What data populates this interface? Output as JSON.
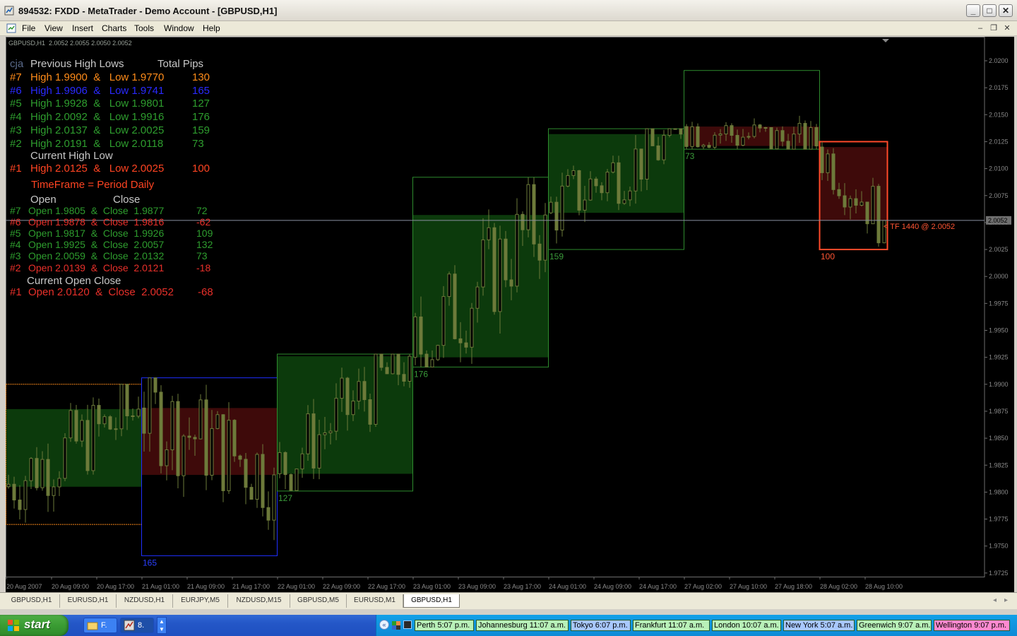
{
  "window": {
    "title": "894532: FXDD - MetaTrader - Demo Account - [GBPUSD,H1]",
    "minimize": "_",
    "maximize": "□",
    "close": "✕"
  },
  "menu": {
    "items": [
      "File",
      "View",
      "Insert",
      "Charts",
      "Tools",
      "Window",
      "Help"
    ]
  },
  "chart": {
    "header": "GBPUSD,H1  2.0052 2.0055 2.0050 2.0052",
    "current_price_tag": "2.0052",
    "tf_label": "< TF 1440  @  2.0052",
    "price_axis": [
      "2.0200",
      "2.0175",
      "2.0150",
      "2.0125",
      "2.0100",
      "2.0075",
      "2.0050",
      "2.0025",
      "2.0000",
      "1.9975",
      "1.9950",
      "1.9925",
      "1.9900",
      "1.9875",
      "1.9850",
      "1.9825",
      "1.9800",
      "1.9775",
      "1.9750",
      "1.9725"
    ],
    "time_axis": [
      "20 Aug 2007",
      "20 Aug 09:00",
      "20 Aug 17:00",
      "21 Aug 01:00",
      "21 Aug 09:00",
      "21 Aug 17:00",
      "22 Aug 01:00",
      "22 Aug 09:00",
      "22 Aug 17:00",
      "23 Aug 01:00",
      "23 Aug 09:00",
      "23 Aug 17:00",
      "24 Aug 01:00",
      "24 Aug 09:00",
      "24 Aug 17:00",
      "27 Aug 02:00",
      "27 Aug 10:00",
      "27 Aug 18:00",
      "28 Aug 02:00",
      "28 Aug 10:00"
    ],
    "day_boxes": [
      {
        "pips": "",
        "high": 1.99,
        "low": 1.977,
        "open": 1.9805,
        "close": 1.9877,
        "border": "#ff8c1a"
      },
      {
        "pips": "165",
        "high": 1.9906,
        "low": 1.9741,
        "open": 1.9878,
        "close": 1.9816,
        "border": "#1f2fff"
      },
      {
        "pips": "127",
        "high": 1.9928,
        "low": 1.9801,
        "open": 1.9817,
        "close": 1.9926,
        "border": "#2e8b2e"
      },
      {
        "pips": "176",
        "high": 2.0092,
        "low": 1.9916,
        "open": 1.9925,
        "close": 2.0057,
        "border": "#2e8b2e"
      },
      {
        "pips": "159",
        "high": 2.0137,
        "low": 2.0025,
        "open": 2.0059,
        "close": 2.0132,
        "border": "#2e8b2e"
      },
      {
        "pips": "73",
        "high": 2.0191,
        "low": 2.0118,
        "open": 2.0139,
        "close": 2.0121,
        "border": "#2e8b2e"
      },
      {
        "pips": "100",
        "high": 2.0125,
        "low": 2.0025,
        "open": 2.012,
        "close": 2.0052,
        "border": "#ff4a2a"
      }
    ]
  },
  "panel": {
    "title_prefix": "cja",
    "title": "Previous High Lows",
    "total_pips": "Total Pips",
    "hl_rows": [
      {
        "id": "#7",
        "text": "High 1.9900  &   Low 1.9770",
        "pips": "130",
        "color": "#ff8c1a"
      },
      {
        "id": "#6",
        "text": "High 1.9906  &   Low 1.9741",
        "pips": "165",
        "color": "#2a2aff"
      },
      {
        "id": "#5",
        "text": "High 1.9928  &   Low 1.9801",
        "pips": "127",
        "color": "#2e9d2e"
      },
      {
        "id": "#4",
        "text": "High 2.0092  &   Low 1.9916",
        "pips": "176",
        "color": "#2e9d2e"
      },
      {
        "id": "#3",
        "text": "High 2.0137  &   Low 2.0025",
        "pips": "159",
        "color": "#2e9d2e"
      },
      {
        "id": "#2",
        "text": "High 2.0191  &   Low 2.0118",
        "pips": "73",
        "color": "#2e9d2e"
      }
    ],
    "current_hl_label": "Current High Low",
    "current_hl": {
      "id": "#1",
      "text": "High 2.0125  &   Low 2.0025",
      "pips": "100",
      "color": "#ff4422"
    },
    "timeframe": "TimeFrame = Period Daily",
    "open_label": "Open",
    "close_label": "Close",
    "oc_rows": [
      {
        "id": "#7",
        "text": "Open 1.9805  &  Close  1.9877",
        "pips": "72",
        "color": "#2e9d2e"
      },
      {
        "id": "#6",
        "text": "Open 1.9878  &  Close  1.9816",
        "pips": "-62",
        "color": "#e8302a"
      },
      {
        "id": "#5",
        "text": "Open 1.9817  &  Close  1.9926",
        "pips": "109",
        "color": "#2e9d2e"
      },
      {
        "id": "#4",
        "text": "Open 1.9925  &  Close  2.0057",
        "pips": "132",
        "color": "#2e9d2e"
      },
      {
        "id": "#3",
        "text": "Open 2.0059  &  Close  2.0132",
        "pips": "73",
        "color": "#2e9d2e"
      },
      {
        "id": "#2",
        "text": "Open 2.0139  &  Close  2.0121",
        "pips": "-18",
        "color": "#e8302a"
      }
    ],
    "current_oc_label": "Current Open Close",
    "current_oc": {
      "id": "#1",
      "text": "Open 2.0120  &  Close  2.0052",
      "pips": "-68",
      "color": "#e8302a"
    }
  },
  "tabs": [
    "GBPUSD,H1",
    "EURUSD,H1",
    "NZDUSD,H1",
    "EURJPY,M5",
    "NZDUSD,M15",
    "GBPUSD,M5",
    "EURUSD,M1",
    "GBPUSD,H1"
  ],
  "active_tab": 7,
  "taskbar": {
    "start": "start",
    "buttons": [
      "F.",
      "8."
    ],
    "clocks": [
      {
        "text": "Perth 5:07 p.m.",
        "bg": "#b8f0b8"
      },
      {
        "text": "Johannesburg 11:07 a.m.",
        "bg": "#b8f0b8"
      },
      {
        "text": "Tokyo 6:07 p.m.",
        "bg": "#a8c8ff"
      },
      {
        "text": "Frankfurt 11:07 a.m.",
        "bg": "#b8f0b8"
      },
      {
        "text": "London 10:07 a.m.",
        "bg": "#b8f0b8"
      },
      {
        "text": "New York 5:07 a.m.",
        "bg": "#a8c8ff"
      },
      {
        "text": "Greenwich 9:07 a.m.",
        "bg": "#b8f0b8"
      },
      {
        "text": "Wellington 9:07 p.m.",
        "bg": "#ff8ad0"
      }
    ]
  }
}
